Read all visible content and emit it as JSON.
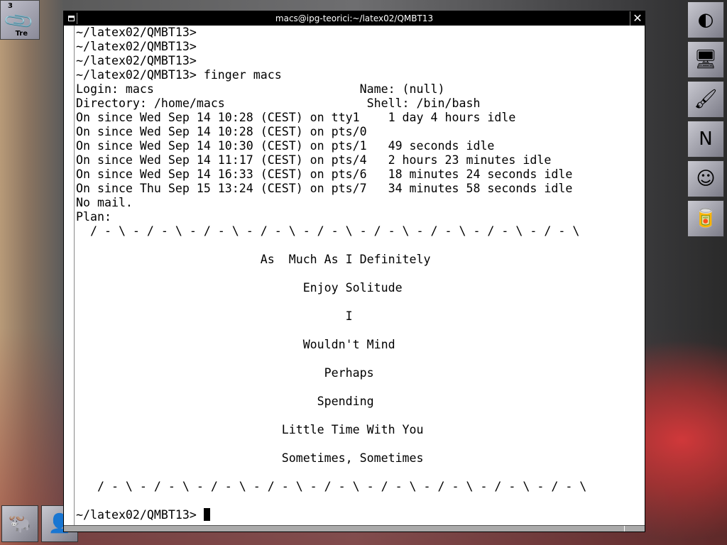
{
  "workspace": {
    "number": "3",
    "name": "Tre",
    "icon": "paperclip-icon"
  },
  "dock_icons": [
    {
      "name": "wmaker-logo-icon",
      "glyph": "◐"
    },
    {
      "name": "monitor-icon",
      "glyph": "🖥"
    },
    {
      "name": "paint-icon",
      "glyph": "🖌"
    },
    {
      "name": "netscape-icon",
      "glyph": "N"
    },
    {
      "name": "bitchx-icon",
      "glyph": "☺"
    },
    {
      "name": "soda-can-icon",
      "glyph": "🥫"
    }
  ],
  "bottom_icons": [
    {
      "name": "gnu-icon",
      "glyph": "🐃"
    },
    {
      "name": "person-icon",
      "glyph": "👤"
    }
  ],
  "window": {
    "title": "macs@ipg-teorici:~/latex02/QMBT13",
    "close_glyph": "✕"
  },
  "terminal": {
    "lines": [
      "~/latex02/QMBT13>",
      "~/latex02/QMBT13>",
      "~/latex02/QMBT13>",
      "~/latex02/QMBT13> finger macs",
      "Login: macs                             Name: (null)",
      "Directory: /home/macs                    Shell: /bin/bash",
      "On since Wed Sep 14 10:28 (CEST) on tty1    1 day 4 hours idle",
      "On since Wed Sep 14 10:28 (CEST) on pts/0",
      "On since Wed Sep 14 10:30 (CEST) on pts/1   49 seconds idle",
      "On since Wed Sep 14 11:17 (CEST) on pts/4   2 hours 23 minutes idle",
      "On since Wed Sep 14 16:33 (CEST) on pts/6   18 minutes 24 seconds idle",
      "On since Thu Sep 15 13:24 (CEST) on pts/7   34 minutes 58 seconds idle",
      "No mail.",
      "Plan:",
      "  / - \\ - / - \\ - / - \\ - / - \\ - / - \\ - / - \\ - / - \\ - / - \\ - / - \\",
      "",
      "                          As  Much As I Definitely",
      "",
      "                                Enjoy Solitude",
      "",
      "                                      I",
      "",
      "                                Wouldn't Mind",
      "",
      "                                   Perhaps",
      "",
      "                                  Spending",
      "",
      "                             Little Time With You",
      "",
      "                             Sometimes, Sometimes",
      "",
      "   / - \\ - / - \\ - / - \\ - / - \\ - / - \\ - / - \\ - / - \\ - / - \\ - / - \\",
      ""
    ],
    "prompt": "~/latex02/QMBT13> "
  }
}
